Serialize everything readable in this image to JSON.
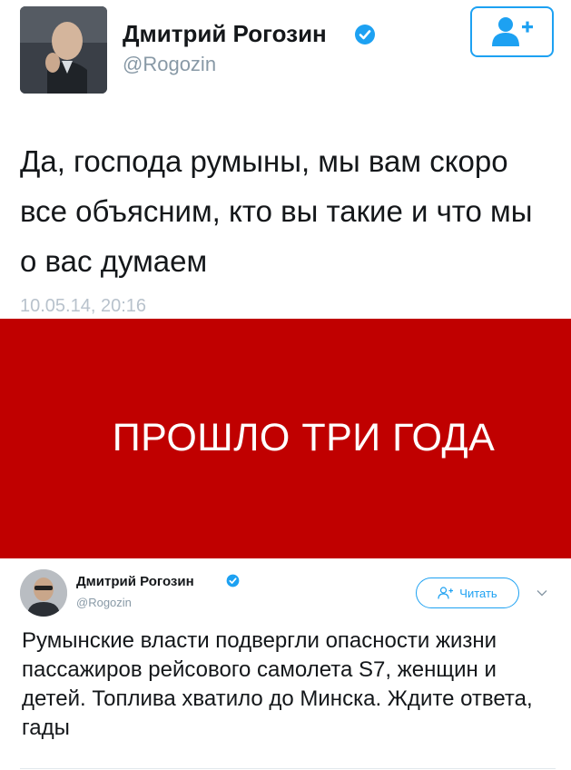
{
  "tweet1": {
    "author_name": "Дмитрий Рогозин",
    "handle": "@Rogozin",
    "text": "Да, господа румыны, мы вам скоро все объясним, кто вы такие и что мы о вас думаем",
    "timestamp": "10.05.14, 20:16",
    "follow_icon": "add-user-icon",
    "verified_icon": "verified-badge-icon"
  },
  "banner": {
    "text": "ПРОШЛО ТРИ ГОДА",
    "color": "#c00000"
  },
  "tweet2": {
    "author_name": "Дмитрий Рогозин",
    "handle": "@Rogozin",
    "follow_label": "Читать",
    "text": "Румынские власти подвергли опасности жизни пассажиров рейсового самолета S7, женщин и детей. Топлива хватило до Минска. Ждите ответа, гады",
    "menu_icon": "chevron-down-icon"
  },
  "colors": {
    "twitter_blue": "#1da1f2",
    "muted": "#8899a6"
  }
}
